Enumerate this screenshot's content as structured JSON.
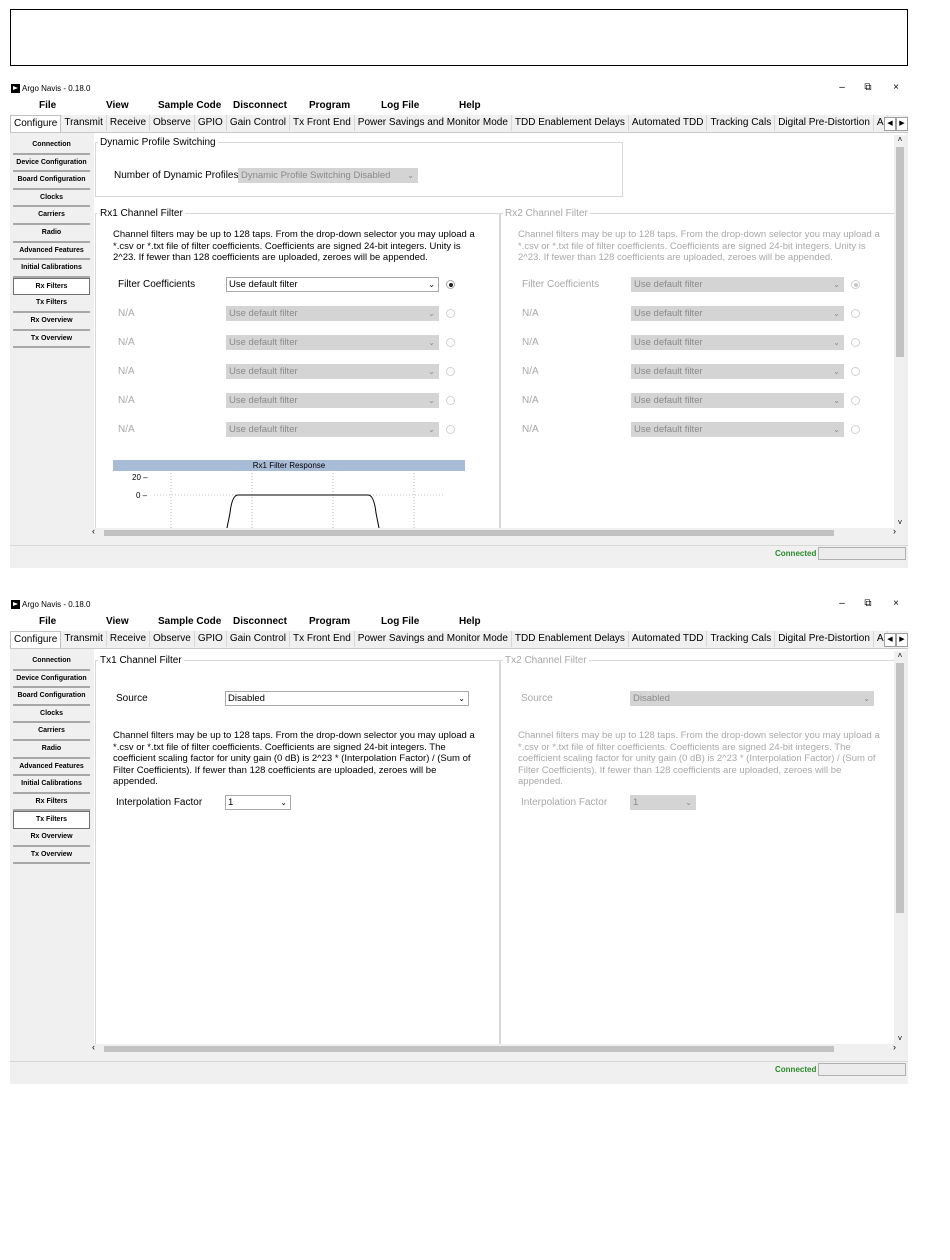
{
  "app": {
    "title": "Argo Navis - 0.18.0",
    "controls": {
      "minimize": "–",
      "restore": "⧉",
      "close": "×"
    },
    "menus": [
      "File",
      "View",
      "Sample Code",
      "Disconnect",
      "Program",
      "Log File",
      "Help"
    ],
    "tabs": [
      "Configure",
      "Transmit",
      "Receive",
      "Observe",
      "GPIO",
      "Gain Control",
      "Tx Front End",
      "Power Savings and Monitor Mode",
      "TDD Enablement Delays",
      "Automated TDD",
      "Tracking Cals",
      "Digital Pre-Distortion",
      "A"
    ],
    "active_tab": "Configure",
    "sidebar": [
      "Connection",
      "Device Configuration",
      "Board Configuration",
      "Clocks",
      "Carriers",
      "Radio",
      "Advanced Features",
      "Initial Calibrations",
      "Rx Filters",
      "Tx Filters",
      "Rx Overview",
      "Tx Overview"
    ],
    "status": "Connected"
  },
  "rx_window": {
    "active_sidebar": "Rx Filters",
    "dps": {
      "legend": "Dynamic Profile Switching",
      "label": "Number of Dynamic Profiles:",
      "value": "Dynamic Profile Switching Disabled"
    },
    "rx1": {
      "legend": "Rx1 Channel Filter",
      "description": "Channel filters may be up to 128 taps. From the drop-down selector you may upload a *.csv or *.txt file of filter coefficients. Coefficients are signed 24-bit integers. Unity is 2^23. If fewer than 128 coefficients are uploaded, zeroes will be appended.",
      "rows": [
        {
          "label": "Filter Coefficients",
          "value": "Use default filter",
          "selected": true
        },
        {
          "label": "N/A",
          "value": "Use default filter",
          "selected": false
        },
        {
          "label": "N/A",
          "value": "Use default filter",
          "selected": false
        },
        {
          "label": "N/A",
          "value": "Use default filter",
          "selected": false
        },
        {
          "label": "N/A",
          "value": "Use default filter",
          "selected": false
        },
        {
          "label": "N/A",
          "value": "Use default filter",
          "selected": false
        }
      ],
      "chart": {
        "title": "Rx1 Filter Response",
        "yticks": [
          "20 –",
          "0 –"
        ]
      }
    },
    "rx2": {
      "legend": "Rx2 Channel Filter",
      "description": "Channel filters may be up to 128 taps. From the drop-down selector you may upload a *.csv or *.txt file of filter coefficients. Coefficients are signed 24-bit integers. Unity is 2^23. If fewer than 128 coefficients are uploaded, zeroes will be appended.",
      "rows": [
        {
          "label": "Filter Coefficients",
          "value": "Use default filter",
          "selected": true
        },
        {
          "label": "N/A",
          "value": "Use default filter",
          "selected": false
        },
        {
          "label": "N/A",
          "value": "Use default filter",
          "selected": false
        },
        {
          "label": "N/A",
          "value": "Use default filter",
          "selected": false
        },
        {
          "label": "N/A",
          "value": "Use default filter",
          "selected": false
        },
        {
          "label": "N/A",
          "value": "Use default filter",
          "selected": false
        }
      ]
    }
  },
  "tx_window": {
    "active_sidebar": "Tx Filters",
    "tx1": {
      "legend": "Tx1 Channel Filter",
      "source_label": "Source",
      "source_value": "Disabled",
      "description": "Channel filters may be up to 128 taps. From the drop-down selector you may upload a *.csv or *.txt file of filter coefficients. Coefficients are signed 24-bit integers. The coefficient scaling factor for unity gain (0 dB) is 2^23 * (Interpolation Factor) / (Sum of Filter Coefficients). If fewer than 128 coefficients are uploaded, zeroes will be appended.",
      "interp_label": "Interpolation Factor",
      "interp_value": "1"
    },
    "tx2": {
      "legend": "Tx2 Channel Filter",
      "source_label": "Source",
      "source_value": "Disabled",
      "description": "Channel filters may be up to 128 taps. From the drop-down selector you may upload a *.csv or *.txt file of filter coefficients. Coefficients are signed 24-bit integers. The coefficient scaling factor for unity gain (0 dB) is 2^23 * (Interpolation Factor) / (Sum of Filter Coefficients). If fewer than 128 coefficients are uploaded, zeroes will be appended.",
      "interp_label": "Interpolation Factor",
      "interp_value": "1"
    }
  }
}
